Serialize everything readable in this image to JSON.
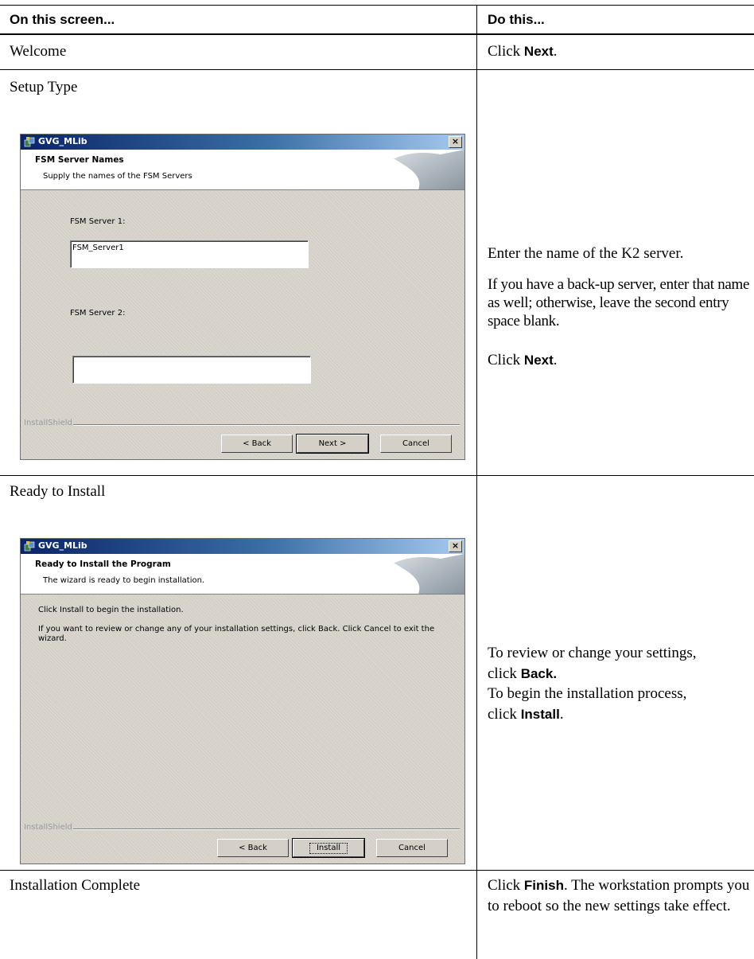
{
  "header": {
    "col1": "On this screen...",
    "col2": "Do this..."
  },
  "rows": [
    {
      "screen": "Welcome",
      "action_prefix": "Click ",
      "action_bold": "Next",
      "action_suffix": "."
    },
    {
      "screen": "Setup Type",
      "action_line1": "Enter the name of the K2 server.",
      "action_para2": "If you have a back-up server, enter that name as well; otherwise, leave the second entry space blank.",
      "action_click_prefix": "Click ",
      "action_click_bold": "Next",
      "action_click_suffix": "."
    },
    {
      "screen": "Ready to Install",
      "action_line1": "To review or change your settings,",
      "action_line2_prefix": "click ",
      "action_line2_bold": "Back.",
      "action_line3": "To begin the installation process,",
      "action_line4_prefix": "click ",
      "action_line4_bold": "Install",
      "action_line4_suffix": "."
    },
    {
      "screen": "Installation Complete",
      "action_prefix": "Click ",
      "action_bold": "Finish",
      "action_suffix": ". The workstation prompts you to reboot so the new settings take effect."
    }
  ],
  "dialog_fsm": {
    "title": "GVG_MLib",
    "close": "×",
    "heading": "FSM Server Names",
    "subheading": "Supply the names of the FSM Servers",
    "label1": "FSM Server 1:",
    "value1": "FSM_Server1",
    "label2": "FSM Server 2:",
    "value2": "",
    "installshield": "InstallShield",
    "back": "< Back",
    "next": "Next >",
    "cancel": "Cancel",
    "icons": {
      "app": "installer-icon",
      "close": "close-icon"
    }
  },
  "dialog_ready": {
    "title": "GVG_MLib",
    "close": "×",
    "heading": "Ready to Install the Program",
    "subheading": "The wizard is ready to begin installation.",
    "body1": "Click Install to begin the installation.",
    "body2": "If you want to review or change any of your installation settings, click Back. Click Cancel to exit the wizard.",
    "installshield": "InstallShield",
    "back": "< Back",
    "install": "Install",
    "cancel": "Cancel"
  },
  "colors": {
    "title_bar_start": "#0a246a",
    "title_bar_end": "#a6caf0",
    "dialog_face": "#d4d0c8"
  }
}
